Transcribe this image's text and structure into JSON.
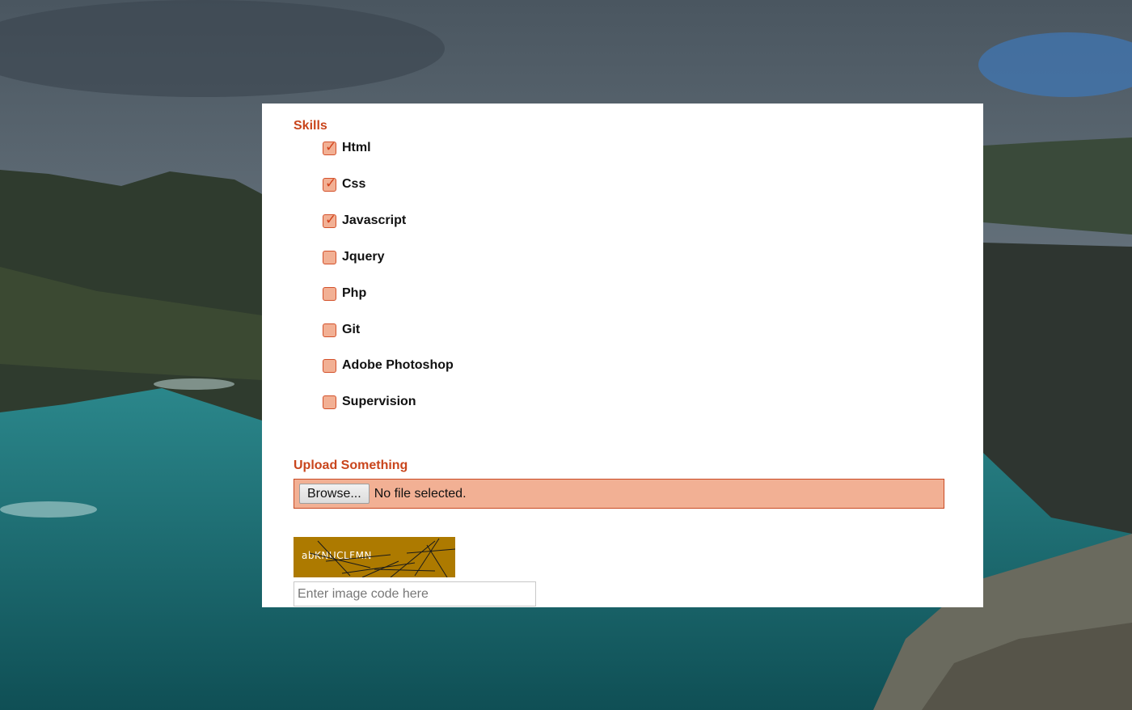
{
  "skills": {
    "title": "Skills",
    "items": [
      {
        "label": "Html",
        "checked": true
      },
      {
        "label": "Css",
        "checked": true
      },
      {
        "label": "Javascript",
        "checked": true
      },
      {
        "label": "Jquery",
        "checked": false
      },
      {
        "label": "Php",
        "checked": false
      },
      {
        "label": "Git",
        "checked": false
      },
      {
        "label": "Adobe Photoshop",
        "checked": false
      },
      {
        "label": "Supervision",
        "checked": false
      }
    ]
  },
  "upload": {
    "title": "Upload Something",
    "browse_label": "Browse...",
    "status": "No file selected."
  },
  "captcha": {
    "code": "abKNUCLFMN",
    "input_placeholder": "Enter image code here",
    "input_value": ""
  },
  "colors": {
    "accent": "#c9451c",
    "checkbox_fill": "#f2b094",
    "captcha_bg": "#ad7a00"
  }
}
